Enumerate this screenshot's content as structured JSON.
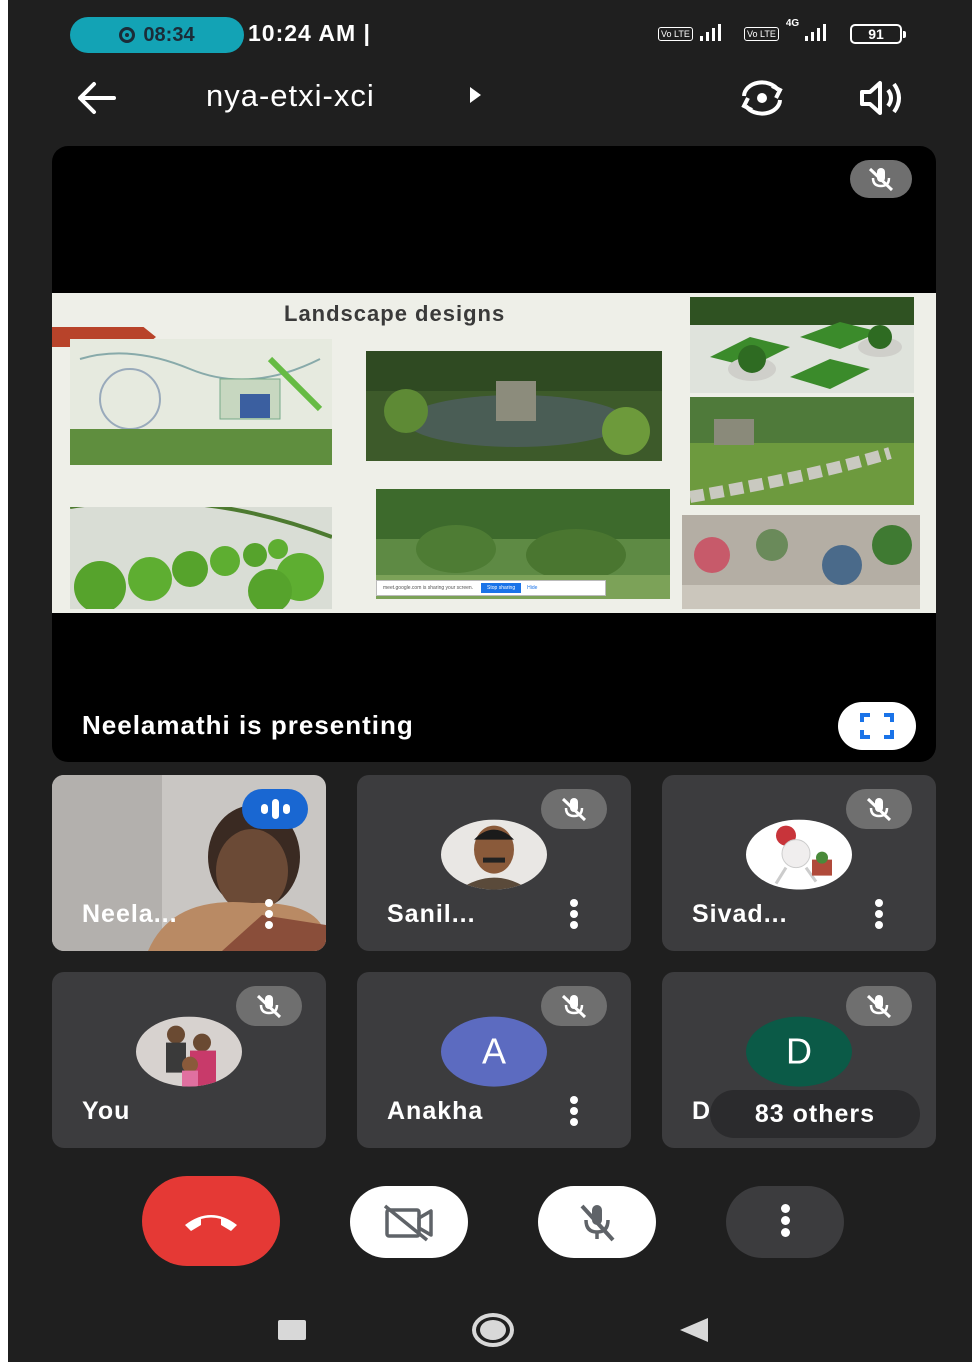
{
  "status_bar": {
    "recording_time": "08:34",
    "clock": "10:24 AM |",
    "network_1": "Vo LTE",
    "network_2": "Vo LTE",
    "network_type": "4G",
    "battery": "91"
  },
  "header": {
    "meeting_code": "nya-etxi-xci",
    "back_icon": "arrow-left-icon",
    "switch_camera_icon": "camera-switch-icon",
    "speaker_icon": "speaker-icon"
  },
  "presentation": {
    "slide_title": "Landscape designs",
    "presenting_text": "Neelamathi is presenting",
    "share_banner": {
      "message": "meet.google.com is sharing your screen.",
      "stop_label": "Stop sharing",
      "hide_label": "Hide"
    }
  },
  "participants": [
    {
      "name": "Neela...",
      "state": "speaking"
    },
    {
      "name": "Sanil...",
      "state": "muted"
    },
    {
      "name": "Sivad...",
      "state": "muted"
    },
    {
      "name": "You",
      "state": "muted"
    },
    {
      "name": "Anakha",
      "avatar_letter": "A",
      "avatar_color": "#5c6bc0",
      "state": "muted"
    },
    {
      "name": "Dr. Anith",
      "avatar_letter": "D",
      "avatar_color": "#0b5a47",
      "state": "muted",
      "others_label": "83 others"
    }
  ],
  "controls": {
    "end_call_color": "#e53935",
    "end_call_icon": "phone-hangup-icon",
    "camera_icon": "video-off-icon",
    "mic_icon": "mic-off-icon",
    "more_icon": "more-vert-icon"
  },
  "colors": {
    "background": "#1f1f1f",
    "tile": "#3c3c3e",
    "recording_pill": "#13a3b5",
    "speaking_badge": "#1967d2"
  }
}
